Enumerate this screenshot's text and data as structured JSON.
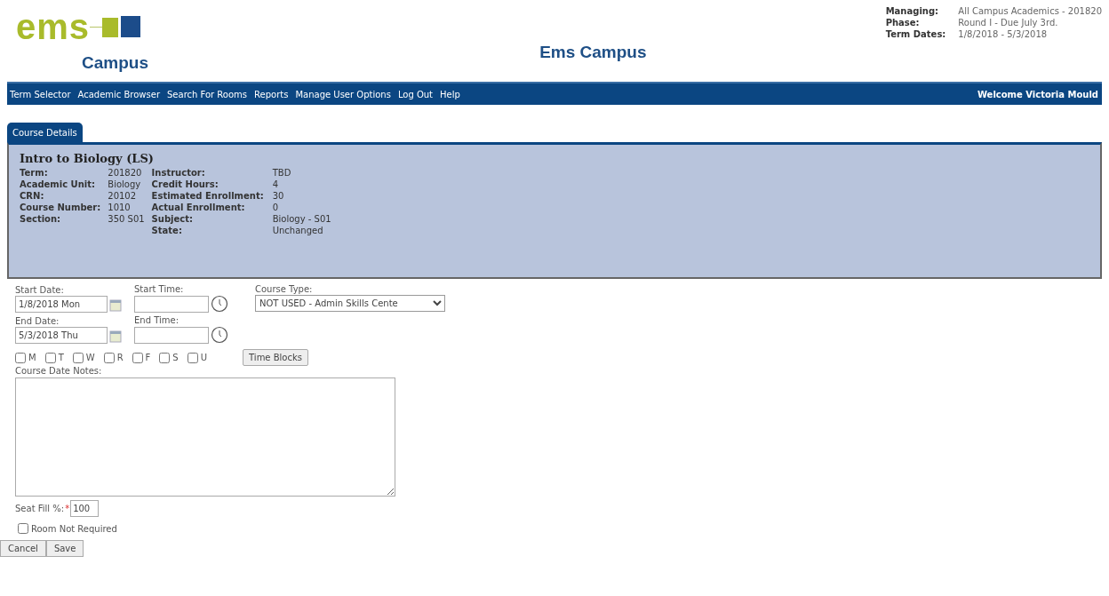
{
  "logo": {
    "word": "ems",
    "subtitle": "Campus"
  },
  "site_title": "Ems Campus",
  "info": [
    {
      "label": "Managing:",
      "value": "All Campus Academics - 201820"
    },
    {
      "label": "Phase:",
      "value": "Round I - Due July 3rd."
    },
    {
      "label": "Term Dates:",
      "value": "1/8/2018 - 5/3/2018"
    }
  ],
  "nav": {
    "items": [
      "Term Selector",
      "Academic Browser",
      "Search For Rooms",
      "Reports",
      "Manage User Options",
      "Log Out",
      "Help"
    ],
    "welcome": "Welcome Victoria Mould"
  },
  "tabs": [
    {
      "label": "Course Details",
      "selected": true
    }
  ],
  "course": {
    "title": "Intro to Biology (LS)",
    "left": [
      {
        "label": "Term:",
        "value": "201820"
      },
      {
        "label": "Academic Unit:",
        "value": "Biology"
      },
      {
        "label": "CRN:",
        "value": "20102"
      },
      {
        "label": "Course Number:",
        "value": "1010"
      },
      {
        "label": "Section:",
        "value": "350 S01"
      }
    ],
    "right": [
      {
        "label": "Instructor:",
        "value": "TBD"
      },
      {
        "label": "Credit Hours:",
        "value": "4"
      },
      {
        "label": "Estimated Enrollment:",
        "value": "30"
      },
      {
        "label": "Actual Enrollment:",
        "value": "0"
      },
      {
        "label": "Subject:",
        "value": "Biology - S01"
      },
      {
        "label": "State:",
        "value": "Unchanged"
      }
    ]
  },
  "form": {
    "start_date": {
      "label": "Start Date:",
      "value": "1/8/2018 Mon"
    },
    "start_time": {
      "label": "Start Time:"
    },
    "course_type": {
      "label": "Course Type:",
      "value": "NOT USED - Admin Skills Cente"
    },
    "end_date": {
      "label": "End Date:",
      "value": "5/3/2018 Thu"
    },
    "end_time": {
      "label": "End Time:"
    },
    "days": [
      {
        "label": "M",
        "checked": false
      },
      {
        "label": "T",
        "checked": false
      },
      {
        "label": "W",
        "checked": false
      },
      {
        "label": "R",
        "checked": false
      },
      {
        "label": "F",
        "checked": false
      },
      {
        "label": "S",
        "checked": false
      },
      {
        "label": "U",
        "checked": false
      }
    ],
    "time_blocks": "Time Blocks",
    "notes": {
      "label": "Course Date Notes:"
    },
    "seat_fill": {
      "label": "Seat Fill %:",
      "required_mark": "*",
      "value": "100"
    },
    "room_not_required": {
      "label": "Room Not Required",
      "checked": false
    },
    "buttons": [
      "Cancel",
      "Save"
    ]
  }
}
